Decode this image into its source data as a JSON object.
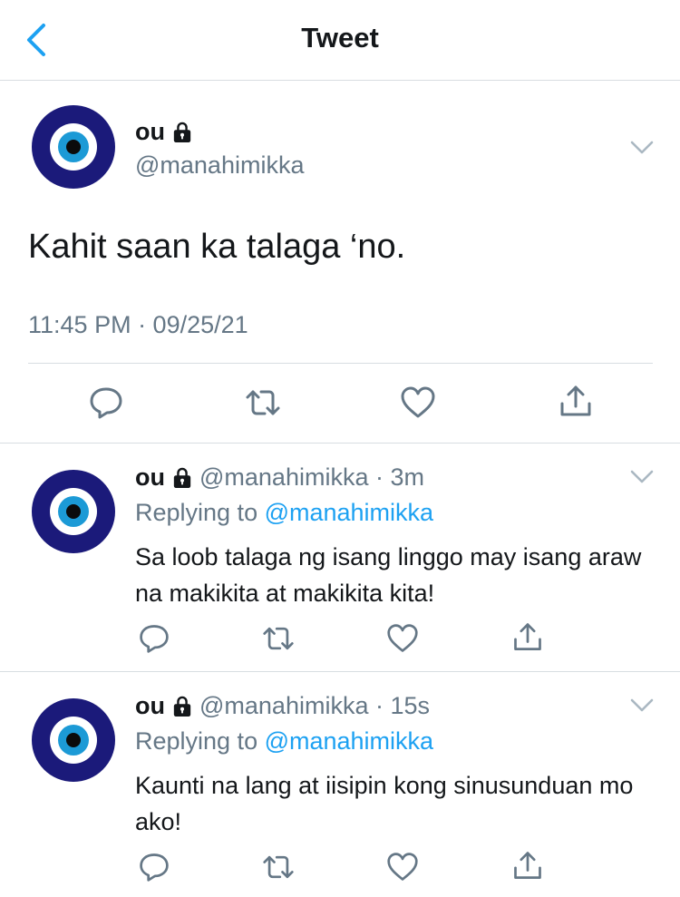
{
  "nav": {
    "title": "Tweet"
  },
  "colors": {
    "accent": "#1da1f2",
    "secondary": "#657786",
    "border": "#d8dde1",
    "avatar_dark": "#1b1a7a",
    "avatar_iris": "#1c9ad6"
  },
  "main_tweet": {
    "display_name": "ou",
    "handle": "@manahimikka",
    "text": "Kahit saan ka talaga ‘no.",
    "timestamp": "11:45 PM · 09/25/21",
    "icons": [
      "reply-icon",
      "retweet-icon",
      "like-icon",
      "share-icon"
    ]
  },
  "replies": [
    {
      "display_name": "ou",
      "handle_time": "@manahimikka · 3m",
      "replying_prefix": "Replying to ",
      "replying_to": "@manahimikka",
      "text": "Sa loob talaga ng isang linggo may isang araw na makikita at makikita kita!"
    },
    {
      "display_name": "ou",
      "handle_time": "@manahimikka · 15s",
      "replying_prefix": "Replying to ",
      "replying_to": "@manahimikka",
      "text": "Kaunti na lang at iisipin kong sinusunduan mo ako!"
    }
  ]
}
